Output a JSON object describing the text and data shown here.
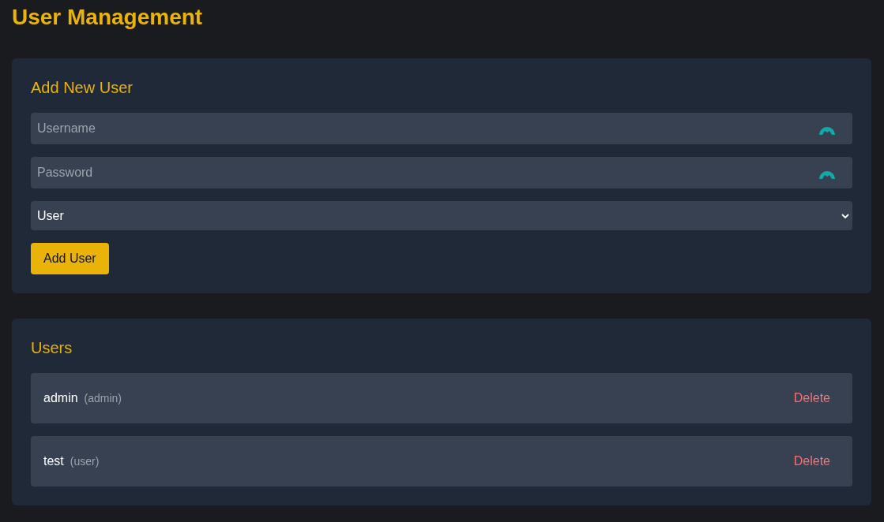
{
  "title": "User Management",
  "add_form": {
    "heading": "Add New User",
    "fields": [
      {
        "placeholder": "Username"
      },
      {
        "placeholder": "Password"
      }
    ],
    "role_select": {
      "value": "User"
    },
    "submit": "Add User"
  },
  "users": {
    "heading": "Users",
    "rows": [
      {
        "name": "admin",
        "role": "(admin)",
        "action": "Delete"
      },
      {
        "name": "test",
        "role": "(user)",
        "action": "Delete"
      }
    ]
  }
}
